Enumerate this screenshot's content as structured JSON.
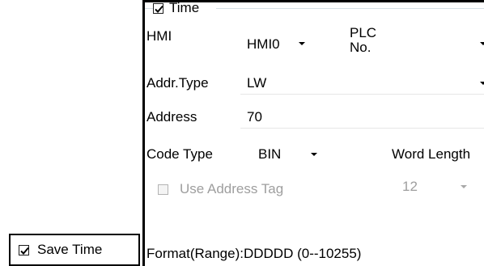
{
  "save_time": {
    "label": "Save Time",
    "checked": true
  },
  "time_group": {
    "title": "Time",
    "checked": true,
    "hmi_label": "HMI",
    "hmi_value": "HMI0",
    "plc_label_line1": "PLC",
    "plc_label_line2": "No.",
    "plc_value": "",
    "addr_type_label": "Addr.Type",
    "addr_type_value": "LW",
    "address_label": "Address",
    "address_value": "70",
    "code_type_label": "Code Type",
    "code_type_value": "BIN",
    "word_length_label": "Word Length",
    "word_length_value": "12",
    "use_address_tag_label": "Use Address Tag",
    "use_address_tag_checked": false,
    "format_text": "Format(Range):DDDDD (0--10255)"
  },
  "icons": [
    "checkbox-check-icon",
    "dropdown-arrow-icon"
  ]
}
